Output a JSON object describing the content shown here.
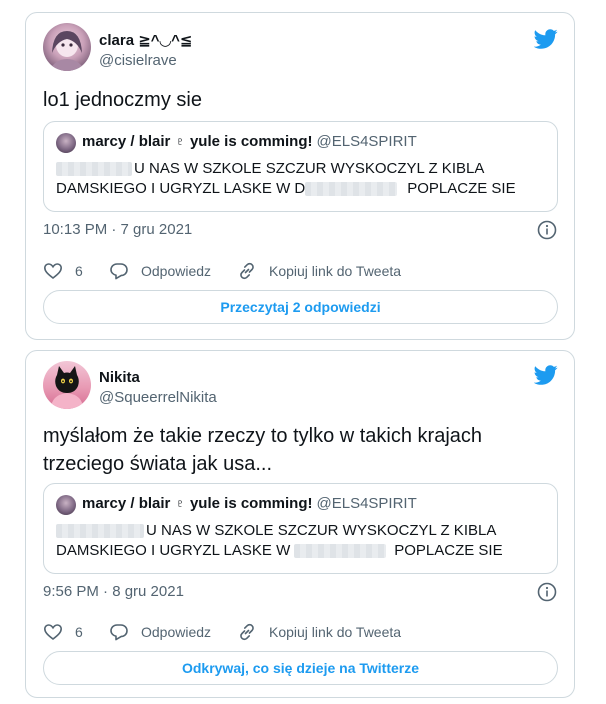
{
  "tweets": [
    {
      "author": {
        "name": "clara ≧^◡^≦",
        "handle": "@cisielrave"
      },
      "text": "lo1 jednoczmy sie",
      "quote": {
        "author_name": "marcy / blair ♇ yule is comming!",
        "author_handle": "@ELS4SPIRIT",
        "line1": "U NAS W SZKOLE SZCZUR WYSKOCZYL Z KIBLA",
        "line2_before": "DAMSKIEGO I UGRYZL LASKE W D",
        "line2_after": "POPLACZE SIE"
      },
      "timestamp": "10:13 PM · 7 gru 2021",
      "likes": "6",
      "reply_label": "Odpowiedz",
      "copy_label": "Kopiuj link do Tweeta",
      "footer_button": "Przeczytaj 2 odpowiedzi"
    },
    {
      "author": {
        "name": "Nikita",
        "handle": "@SqueerrelNikita"
      },
      "text_line1": "myślałom że takie rzeczy to tylko w takich krajach",
      "text_line2": "trzeciego świata jak usa...",
      "quote": {
        "author_name": "marcy / blair ♇ yule is comming!",
        "author_handle": "@ELS4SPIRIT",
        "line1": "U NAS W SZKOLE SZCZUR WYSKOCZYL Z KIBLA",
        "line2_before": "DAMSKIEGO I UGRYZL LASKE W",
        "line2_after": "POPLACZE SIE"
      },
      "timestamp": "9:56 PM · 8 gru 2021",
      "likes": "6",
      "reply_label": "Odpowiedz",
      "copy_label": "Kopiuj link do Tweeta",
      "footer_button": "Odkrywaj, co się dzieje na Twitterze"
    }
  ],
  "colors": {
    "accent": "#1d9bf0",
    "muted": "#536471",
    "border": "#cfd9de",
    "text": "#0f1419"
  },
  "icons": [
    "twitter-bird-icon",
    "info-icon",
    "heart-icon",
    "reply-bubble-icon",
    "link-icon"
  ]
}
